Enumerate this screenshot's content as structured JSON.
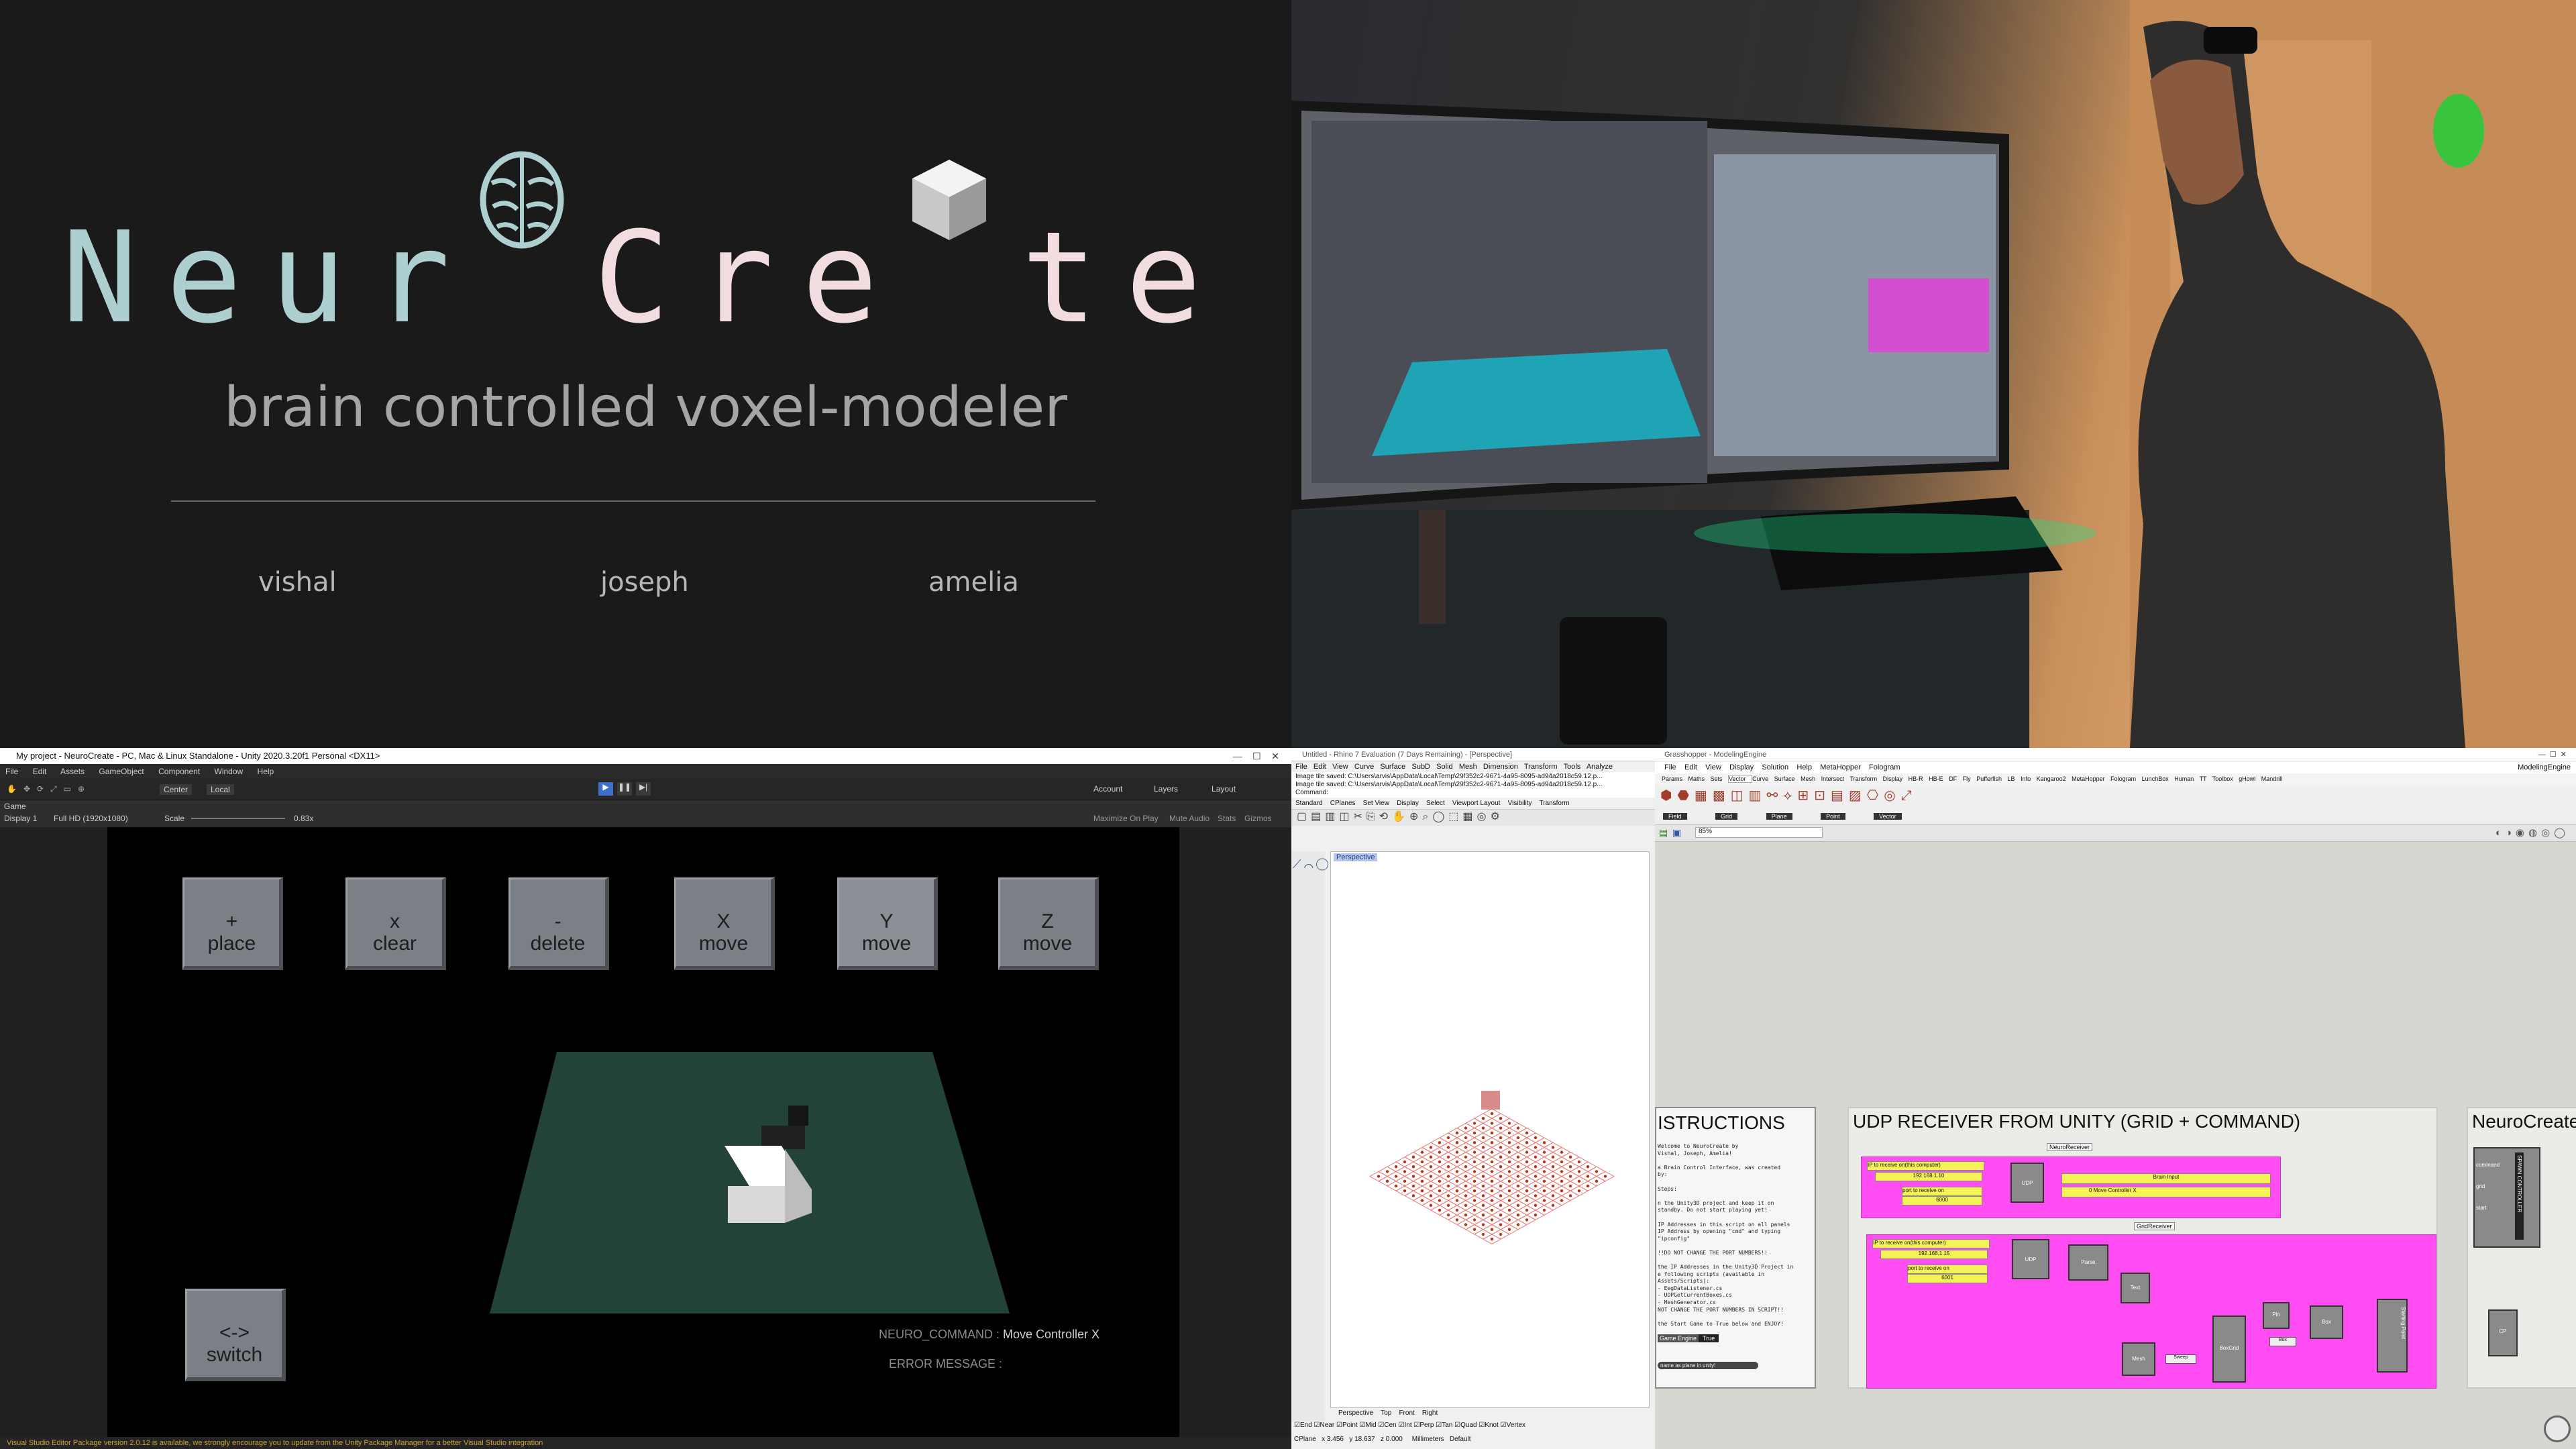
{
  "title_card": {
    "brand_part1": "Neur",
    "brand_part2": "Cre",
    "brand_part3": "te",
    "subtitle": "brain controlled voxel-modeler",
    "authors": [
      "vishal",
      "joseph",
      "amelia"
    ]
  },
  "unity": {
    "window_title": "My project - NeuroCreate - PC, Mac & Linux Standalone - Unity 2020.3.20f1 Personal <DX11>",
    "menu": [
      "File",
      "Edit",
      "Assets",
      "GameObject",
      "Component",
      "Window",
      "Help"
    ],
    "toolbar": {
      "center": "Center",
      "local": "Local",
      "account": "Account",
      "layers": "Layers",
      "layout": "Layout"
    },
    "game_tab": "Game",
    "display": "Display 1",
    "resolution": "Full HD (1920x1080)",
    "scale_label": "Scale",
    "scale_value": "0.83x",
    "game_options": [
      "Maximize On Play",
      "Mute Audio",
      "Stats",
      "Gizmos"
    ],
    "buttons": [
      {
        "symbol": "+",
        "label": "place"
      },
      {
        "symbol": "x",
        "label": "clear"
      },
      {
        "symbol": "-",
        "label": "delete"
      },
      {
        "symbol": "X",
        "label": "move"
      },
      {
        "symbol": "Y",
        "label": "move"
      },
      {
        "symbol": "Z",
        "label": "move"
      }
    ],
    "switch_button": {
      "symbol": "<->",
      "label": "switch"
    },
    "neuro_command_label": "NEURO_COMMAND :",
    "neuro_command_value": "Move Controller X",
    "error_message_label": "ERROR MESSAGE :",
    "status_message": "Visual Studio Editor Package version 2.0.12 is available, we strongly encourage you to update from the Unity Package Manager for a better Visual Studio integration",
    "colors": {
      "ground": "#23423a",
      "button": "#7b7f86",
      "voxel": "#ffffff"
    }
  },
  "rhino": {
    "window_title": "Untitled - Rhino 7 Evaluation (7 Days Remaining) - [Perspective]",
    "menu": [
      "File",
      "Edit",
      "View",
      "Curve",
      "Surface",
      "SubD",
      "Solid",
      "Mesh",
      "Dimension",
      "Transform",
      "Tools",
      "Analyze"
    ],
    "log": [
      "Image tile saved: C:\\Users\\arvis\\AppData\\Local\\Temp\\29f352c2-9671-4a95-8095-ad94a2018c59.12.p...",
      "Image tile saved: C:\\Users\\arvis\\AppData\\Local\\Temp\\29f352c2-9671-4a95-8095-ad94a2018c59.12.p..."
    ],
    "command_label": "Command:",
    "tabs": [
      "Standard",
      "CPlanes",
      "Set View",
      "Display",
      "Select",
      "Viewport Layout",
      "Visibility",
      "Transform"
    ],
    "viewport_label": "Perspective",
    "view_tabs": [
      "Perspective",
      "Top",
      "Front",
      "Right"
    ],
    "osnaps": [
      "End",
      "Near",
      "Point",
      "Mid",
      "Cen",
      "Int",
      "Perp",
      "Tan",
      "Quad",
      "Knot",
      "Vertex"
    ],
    "status": {
      "cplane": "CPlane",
      "x": "x 3.456",
      "y": "y 18.637",
      "z": "z 0.000",
      "units": "Millimeters",
      "layer": "Default"
    }
  },
  "grasshopper": {
    "window_title": "Grasshopper - ModelingEngine",
    "doc_name": "ModelingEngine",
    "menu": [
      "File",
      "Edit",
      "View",
      "Display",
      "Solution",
      "Help",
      "MetaHopper",
      "Fologram"
    ],
    "tabs": [
      "Params",
      "Maths",
      "Sets",
      "Vector",
      "Curve",
      "Surface",
      "Mesh",
      "Intersect",
      "Transform",
      "Display",
      "HB-R",
      "HB-E",
      "DF",
      "Fly",
      "Pufferfish",
      "LB",
      "Info",
      "Kangaroo2",
      "MetaHopper",
      "Fologram",
      "LunchBox",
      "Human",
      "TT Toolbox",
      "gHowl",
      "Mandrill"
    ],
    "ribbon_groups": [
      "Field",
      "Grid",
      "Plane",
      "Point",
      "Vector"
    ],
    "zoom": "85%",
    "instructions_heading": "ISTRUCTIONS",
    "instructions_lines": [
      "Welcome to NeuroCreate by",
      "Vishal, Joseph, Amelia!",
      "",
      "a Brain Control Interface, was created",
      "by:",
      "",
      "Steps:",
      "",
      "n the Unity3D project and keep it on",
      "standby. Do not start playing yet!",
      "",
      "IP Addresses in this script on all panels",
      "IP Address by opening \"cmd\" and typing",
      "\"ipconfig\"",
      "",
      "!!DO NOT CHANGE THE PORT NUMBERS!!",
      "",
      "the IP Addresses in the Unity3D Project in",
      "e following scripts (available in",
      "Assets/Scripts):",
      "- EegDataListener.cs",
      "- UDPGetCurrentBoxes.cs",
      "- MeshGenerator.cs",
      "NOT CHANGE THE PORT NUMBERS IN SCRIPT!!",
      "",
      "the Start Game to True below and ENJOY!"
    ],
    "toggle_label": "Game Engine",
    "toggle_value": "True",
    "panel_caption": "name as plane in unity!",
    "receiver_heading": "UDP RECEIVER FROM UNITY (GRID + COMMAND)",
    "neuro_heading": "NeuroCreate",
    "component_labels": {
      "neuro_receiver": "NeuroReceiver",
      "ip_hint": "IP to receive on(this computer)",
      "ip_value": "192.168.1.10",
      "port_hint": "port to receive on",
      "port_value": "6000",
      "brain_input": "Brain Input",
      "move_output": "0 Move Controller X",
      "grid_receiver": "GridReceiver",
      "ip_value_2": "192.168.1.15",
      "port_value_2": "6001",
      "udp": "UDP",
      "parse": "Parse",
      "text": "Text",
      "mesh": "Mesh",
      "sweep": "Sweep",
      "box_grid": "BoxGrid",
      "pln": "Pln",
      "box": "Box",
      "starting_point": "Starting Point",
      "spawn_controller": "SPAWN CONTROLLER",
      "command": "command",
      "grid": "grid",
      "start": "start",
      "cp": "CP"
    },
    "colors": {
      "pink": "#ff4cf3",
      "yellow": "#f5f257",
      "canvas": "#d7d7d2"
    }
  }
}
